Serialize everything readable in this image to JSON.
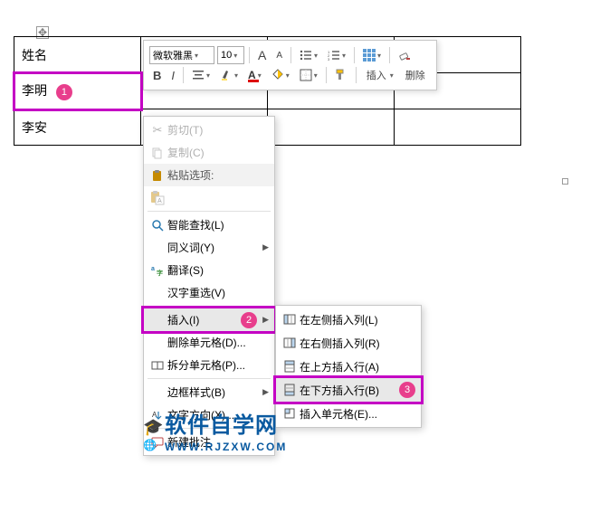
{
  "table": {
    "rows": [
      {
        "c0": "姓名",
        "c1": "",
        "c2": "",
        "c3": ""
      },
      {
        "c0": "李明",
        "c1": "",
        "c2": "",
        "c3": ""
      },
      {
        "c0": "李安",
        "c1": "",
        "c2": "",
        "c3": ""
      }
    ]
  },
  "badges": {
    "b1": "1",
    "b2": "2",
    "b3": "3"
  },
  "toolbar": {
    "font_name": "微软雅黑",
    "font_size": "10",
    "bold": "B",
    "italic": "I",
    "insert": "插入",
    "delete": "删除",
    "grow": "A",
    "shrink": "A"
  },
  "ctx": {
    "cut": "剪切(T)",
    "copy": "复制(C)",
    "paste_header": "粘贴选项:",
    "smart_lookup": "智能查找(L)",
    "synonyms": "同义词(Y)",
    "translate": "翻译(S)",
    "hanzi": "汉字重选(V)",
    "insert": "插入(I)",
    "delete_cell": "删除单元格(D)...",
    "split_cell": "拆分单元格(P)...",
    "border_style": "边框样式(B)",
    "text_dir": "文字方向(X)...",
    "new_comment": "新建批注"
  },
  "sub": {
    "col_left": "在左侧插入列(L)",
    "col_right": "在右侧插入列(R)",
    "row_above": "在上方插入行(A)",
    "row_below": "在下方插入行(B)",
    "ins_cell": "插入单元格(E)..."
  },
  "wm": {
    "title": "软件自学网",
    "url": "WWW.RJZXW.COM"
  }
}
